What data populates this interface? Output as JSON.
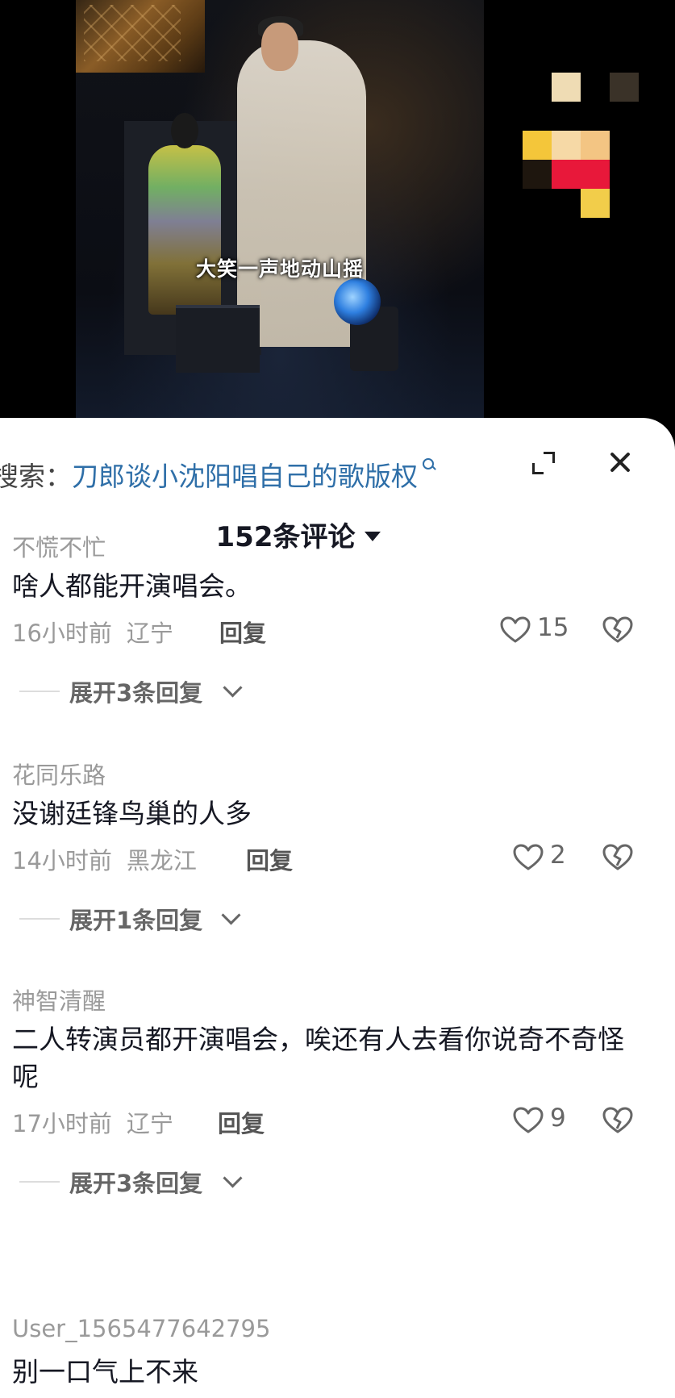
{
  "video": {
    "subtitle": "大笑一声地动山摇"
  },
  "search": {
    "prefix": "搜索：",
    "query": "刀郎谈小沈阳唱自己的歌版权"
  },
  "header": {
    "comment_count": "152条评论"
  },
  "comments": [
    {
      "username": "不慌不忙",
      "content": "啥人都能开演唱会。",
      "time": "16小时前",
      "region": "辽宁",
      "reply_label": "回复",
      "likes": "15",
      "expand_label": "展开3条回复"
    },
    {
      "username": "花同乐路",
      "content": "没谢廷锋鸟巢的人多",
      "time": "14小时前",
      "region": "黑龙江",
      "reply_label": "回复",
      "likes": "2",
      "expand_label": "展开1条回复"
    },
    {
      "username": "神智清醒",
      "content": "二人转演员都开演唱会，唉还有人去看你说奇不奇怪呢",
      "time": "17小时前",
      "region": "辽宁",
      "reply_label": "回复",
      "likes": "9",
      "expand_label": "展开3条回复"
    },
    {
      "username": "User_1565477642795",
      "content": "别一口气上不来"
    }
  ],
  "colors": {
    "accent_link": "#2f6fa8",
    "meta_text": "#9a9a9a",
    "primary_text": "#161823"
  }
}
